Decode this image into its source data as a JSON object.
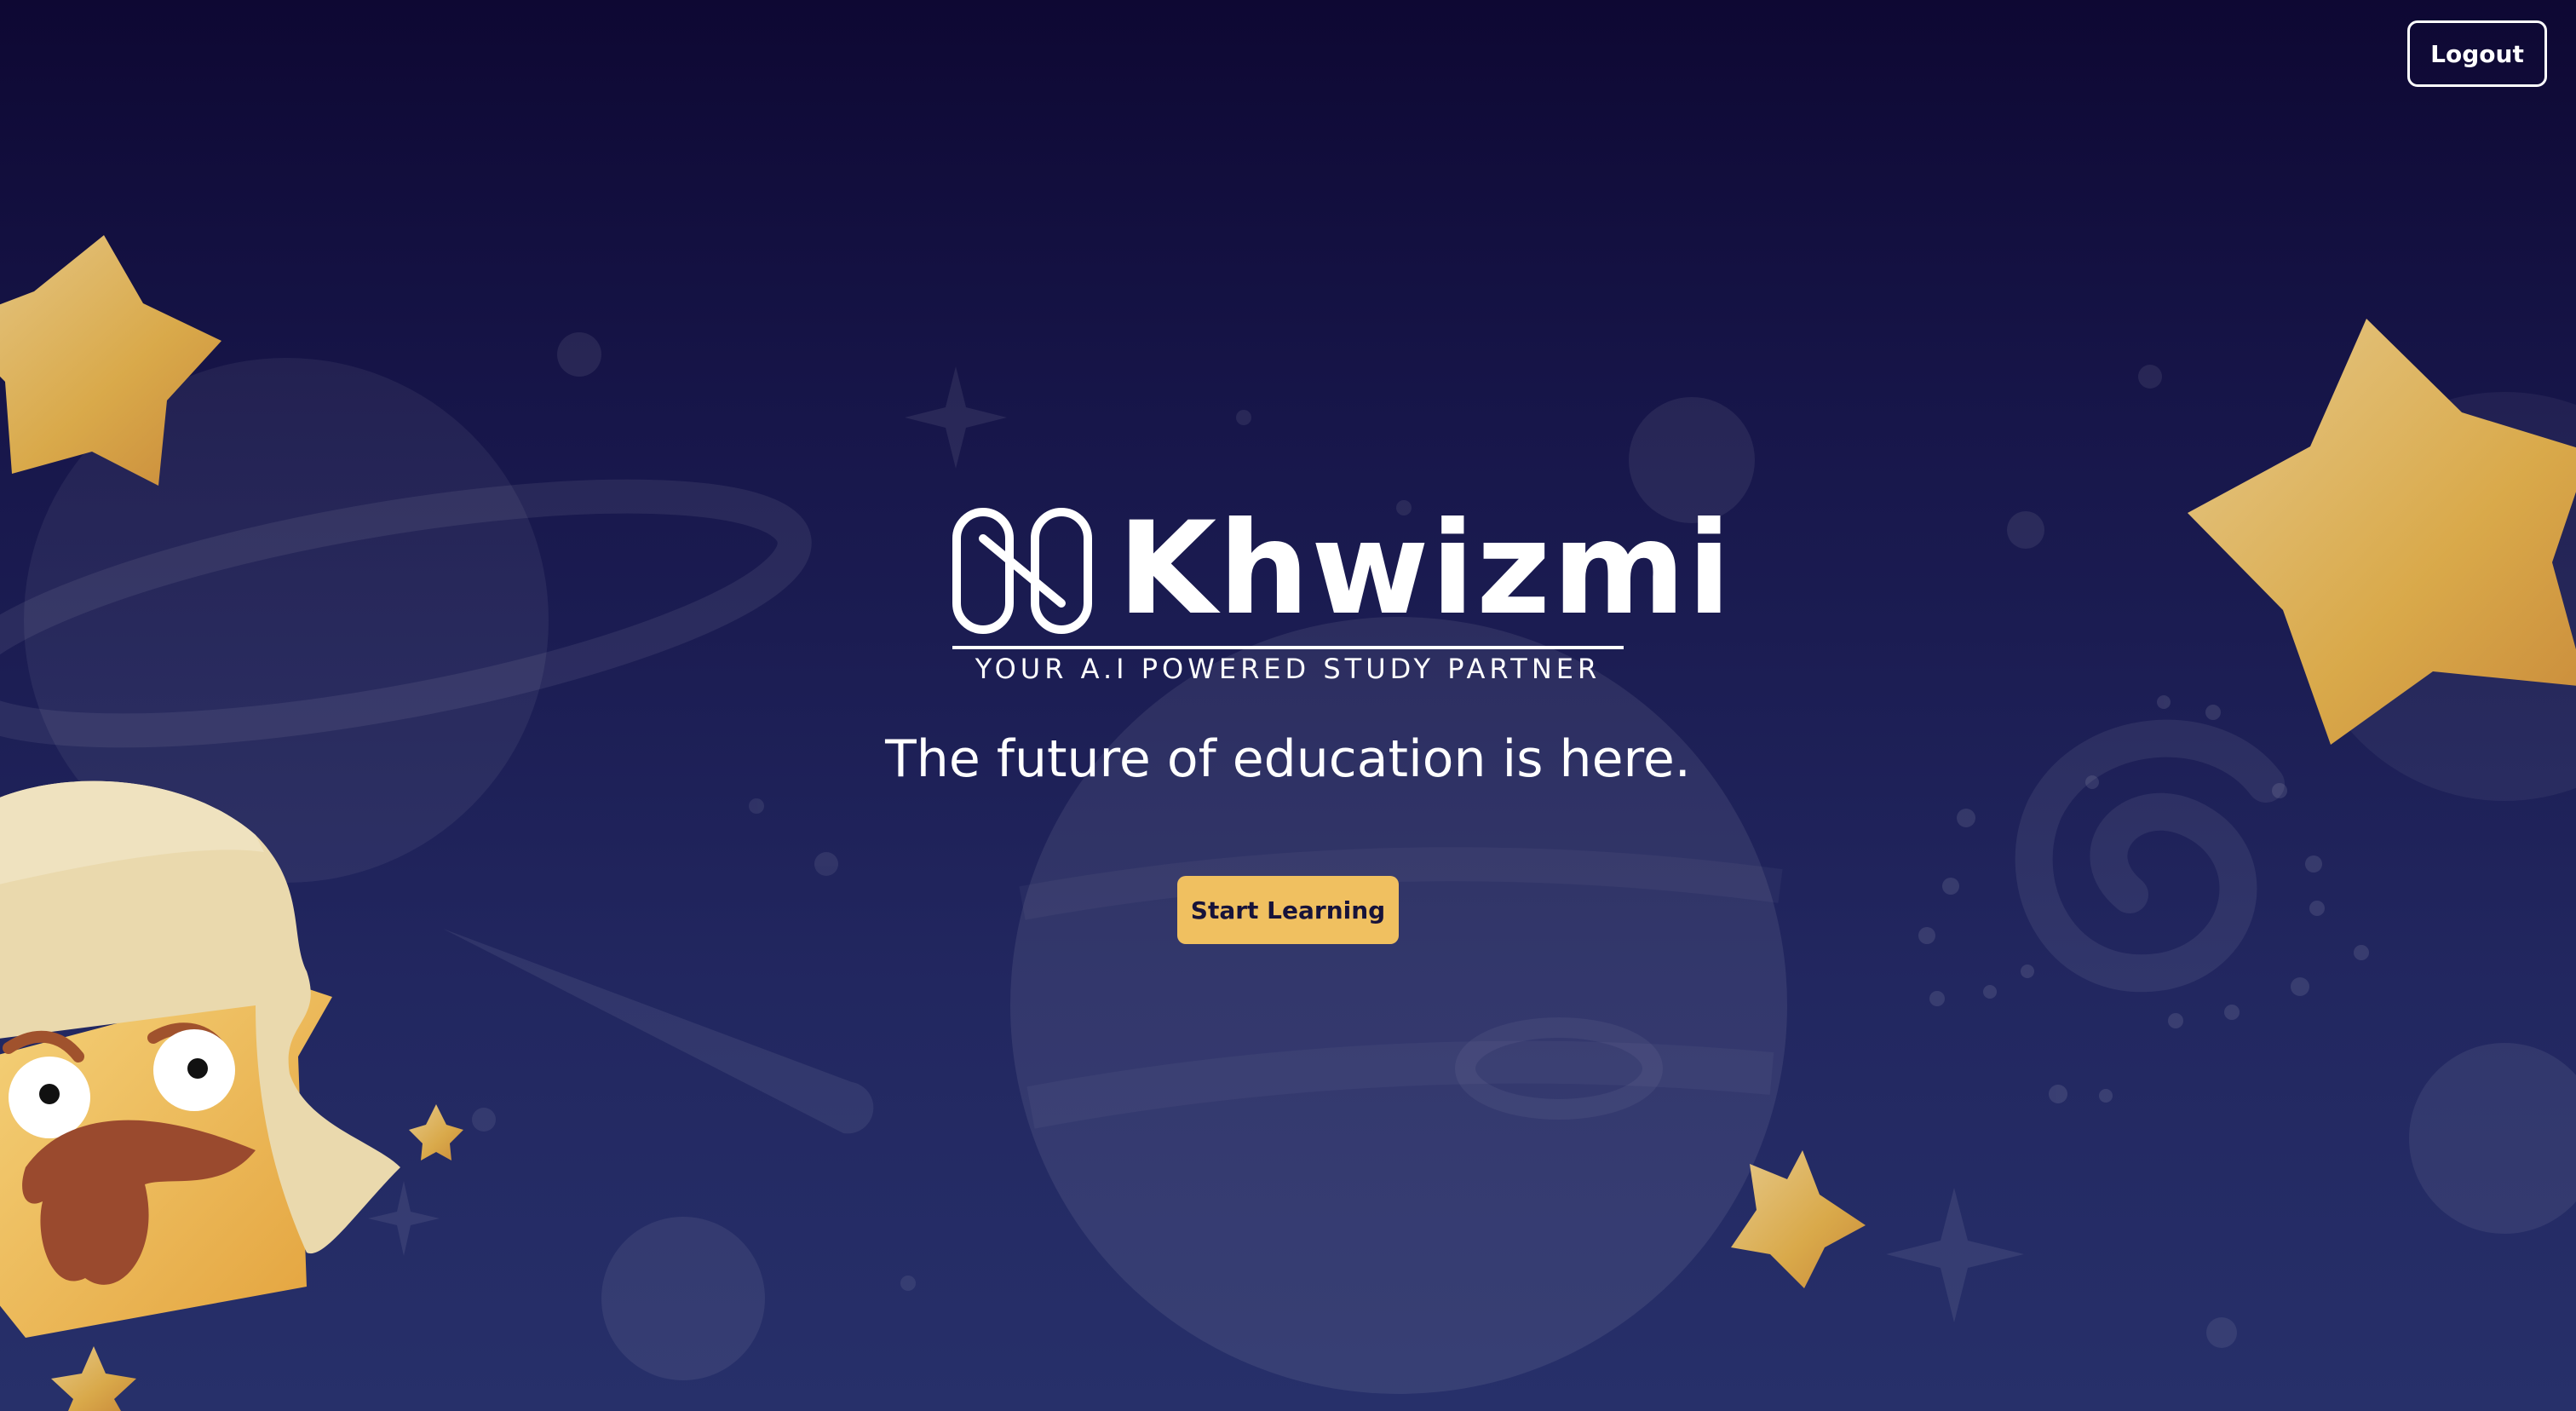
{
  "header": {
    "logout_label": "Logout"
  },
  "brand": {
    "name": "Khwizmi",
    "tagline": "YOUR A.I POWERED STUDY PARTNER",
    "logo_icon": "infinity-n-logo-icon"
  },
  "hero": {
    "headline": "The future of education is here.",
    "cta_label": "Start Learning"
  },
  "colors": {
    "background_top": "#0e0833",
    "background_bottom": "#27306a",
    "accent": "#f0c060",
    "text": "#ffffff"
  }
}
